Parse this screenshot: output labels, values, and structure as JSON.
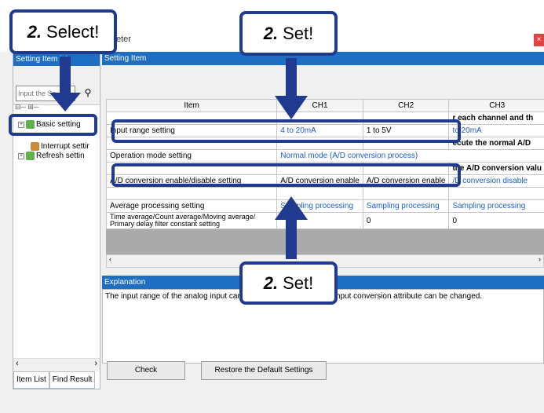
{
  "window": {
    "title": "eter",
    "close_label": "×"
  },
  "left": {
    "header": "Setting Item  ist",
    "search_placeholder": "Input the Se  ng",
    "tree": [
      {
        "label": "Basic setting"
      },
      {
        "label": "Interrupt settir"
      },
      {
        "label": "Refresh settin"
      }
    ],
    "tabs": [
      "Item List",
      "Find Result"
    ]
  },
  "right": {
    "header": "Setting Item",
    "columns": [
      "Item",
      "CH1",
      "CH2",
      "CH3"
    ],
    "group_partial": "r each channel and th",
    "rows": [
      {
        "item": "Input range setting",
        "ch1": "4 to 20mA",
        "ch2": "1 to 5V",
        "ch3": "to 20mA"
      },
      {
        "item": "",
        "ch1": "",
        "ch2": "",
        "ch3": "ecute the normal A/D"
      },
      {
        "item": "Operation mode setting",
        "ch1": "Normal mode (A/D conversion process)",
        "ch2": "",
        "ch3": ""
      },
      {
        "item": "",
        "ch1": "",
        "ch2": "",
        "ch3": "the A/D conversion valu"
      },
      {
        "item": "A/D conversion enable/disable setting",
        "ch1": "A/D conversion enable",
        "ch2": "A/D conversion enable",
        "ch3": "/D conversion disable"
      },
      {
        "item": "Average processing setting",
        "ch1": "Sampling processing",
        "ch2": "Sampling processing",
        "ch3": "Sampling processing"
      },
      {
        "item": "Time average/Count average/Moving average/",
        "ch1": "",
        "ch2": "0",
        "ch3": "0"
      },
      {
        "item": "Primary delay filter constant setting",
        "ch1": "",
        "ch2": "",
        "ch3": ""
      }
    ],
    "explanation_header": "Explanation",
    "explanation_text": "The input range of the analog input can",
    "explanation_text2": "the input conversion attribute can be changed.",
    "check_label": "Check",
    "restore_label": "Restore the Default Settings"
  },
  "callouts": {
    "select": {
      "num": "2.",
      "text": "Select!"
    },
    "set1": {
      "num": "2.",
      "text": "Set!"
    },
    "set2": {
      "num": "2.",
      "text": "Set!"
    }
  }
}
